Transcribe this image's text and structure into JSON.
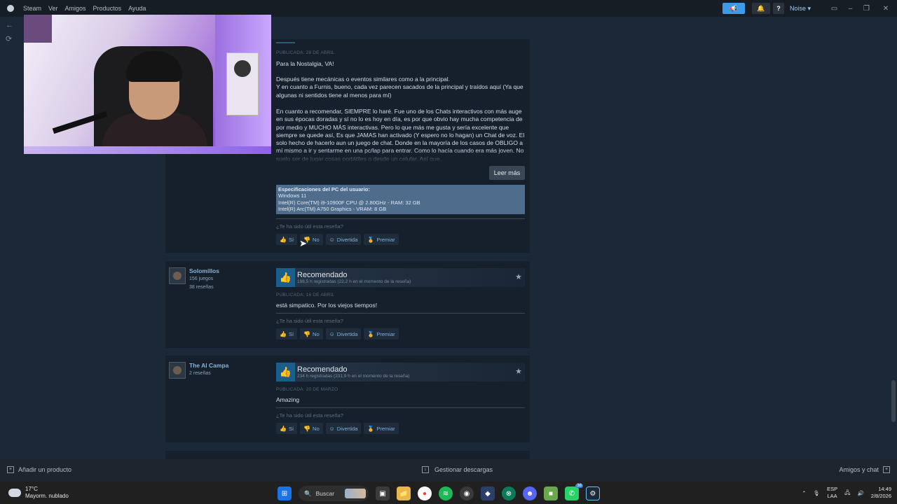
{
  "titlebar": {
    "menu": [
      "Steam",
      "Ver",
      "Amigos",
      "Productos",
      "Ayuda"
    ],
    "user": "Noise",
    "icons": [
      "megaphone-icon",
      "bell-icon",
      "help-icon",
      "chevron-down-icon",
      "monitor-icon",
      "minimize-icon",
      "maximize-icon",
      "close-icon"
    ]
  },
  "reviews": [
    {
      "posted": "PUBLICADA: 28 DE ABRIL",
      "paragraphs": [
        "Para la Nostalgia, VA!",
        "Después tiene mecánicas o eventos similares como a la principal.\nY en cuanto a Furnis, bueno, cada vez parecen sacados de la principal y traídos aquí (Ya que algunas ni sentidos tiene al menos para mí)",
        "En cuanto a recomendar, SIEMPRE lo haré. Fue uno de los Chats interactivos con más auge en sus épocas doradas y sí no lo es hoy en día, es por que obvio hay mucha competencia de por medio y MUCHO MÁS interactivas. Pero lo que más me gusta y sería excelente que siempre se quede así, Es que JAMAS han activado (Y espero no lo hagan) un Chat de voz. El solo hecho de hacerlo aun un juego de chat. Donde en la mayoría de los casos de OBLIGO a mí mismo a ir y sentarme en una pc/lap para entrar. Como lo hacía cuando era más joven. No suelo ser de jugar cosas portátiles o desde un celular. Así que"
      ],
      "read_more": "Leer más",
      "specs_title": "Especificaciones del PC del usuario:",
      "specs": [
        "Windows 11",
        "Intel(R) Core(TM) i9-10900F CPU @ 2.80GHz - RAM: 32 GB",
        "Intel(R) Arc(TM) A750 Graphics - VRAM: 8 GB"
      ],
      "helpful": "¿Te ha sido útil esta reseña?"
    },
    {
      "author": "Solomillos",
      "author_meta": [
        "156 juegos",
        "38 reseñas"
      ],
      "verdict": "Recomendado",
      "hours": "198,5 h registradas (22,2 h en el momento de la reseña)",
      "posted": "PUBLICADA: 16 DE ABRIL",
      "body": "está simpatico. Por los viejos tiempos!",
      "helpful": "¿Te ha sido útil esta reseña?"
    },
    {
      "author": "The Al Campa",
      "author_meta": [
        "2 reseñas"
      ],
      "verdict": "Recomendado",
      "hours": "234 h registradas (231,9 h en el momento de la reseña)",
      "posted": "PUBLICADA: 20 DE MARZO",
      "body": "Amazing",
      "helpful": "¿Te ha sido útil esta reseña?"
    }
  ],
  "votes": {
    "yes": "Sí",
    "no": "No",
    "funny": "Divertida",
    "award": "Premiar"
  },
  "bottombar": {
    "add_product": "Añadir un producto",
    "downloads": "Gestionar descargas",
    "friends": "Amigos y chat"
  },
  "taskbar": {
    "temp": "17°C",
    "weather": "Mayorm. nublado",
    "search": "Buscar",
    "lang1": "ESP",
    "lang2": "LAA",
    "time": "14:49",
    "date": "2/8/2026",
    "whatsapp_badge": "38"
  },
  "colors": {
    "accent": "#3d9ae8",
    "bg": "#1b2838",
    "panel": "#16202d",
    "specs": "#4e6c8c"
  }
}
